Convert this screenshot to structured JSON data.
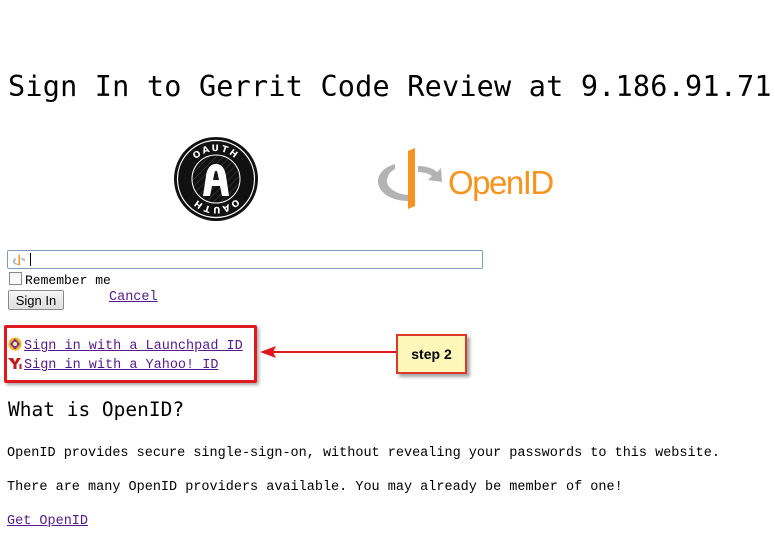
{
  "page": {
    "title": "Sign In to Gerrit Code Review at 9.186.91.71"
  },
  "logos": {
    "oauth": {
      "ring_text_top": "OAUTH",
      "ring_text_bottom": "OAUTH",
      "center_letter": "A"
    },
    "openid": {
      "wordmark": "OpenID",
      "color": "#f7931e"
    }
  },
  "login_form": {
    "openid_input_value": "",
    "remember_me_label": "Remember me",
    "remember_me_checked": false,
    "sign_in_label": "Sign In",
    "cancel_label": "Cancel"
  },
  "providers": [
    {
      "label": "Sign in with a Launchpad ID",
      "icon": "launchpad-icon"
    },
    {
      "label": "Sign in with a Yahoo! ID",
      "icon": "yahoo-icon"
    }
  ],
  "annotation": {
    "callout_label": "step 2",
    "box_color": "#e0191e",
    "callout_bg": "#fdf7b9"
  },
  "info": {
    "heading": "What is OpenID?",
    "paragraph1": "OpenID provides secure single-sign-on, without revealing your passwords to this website.",
    "paragraph2": "There are many OpenID providers available. You may already be member of one!",
    "get_openid_label": "Get OpenID"
  },
  "colors": {
    "link": "#551a8b",
    "input_border": "#7f9db9"
  }
}
